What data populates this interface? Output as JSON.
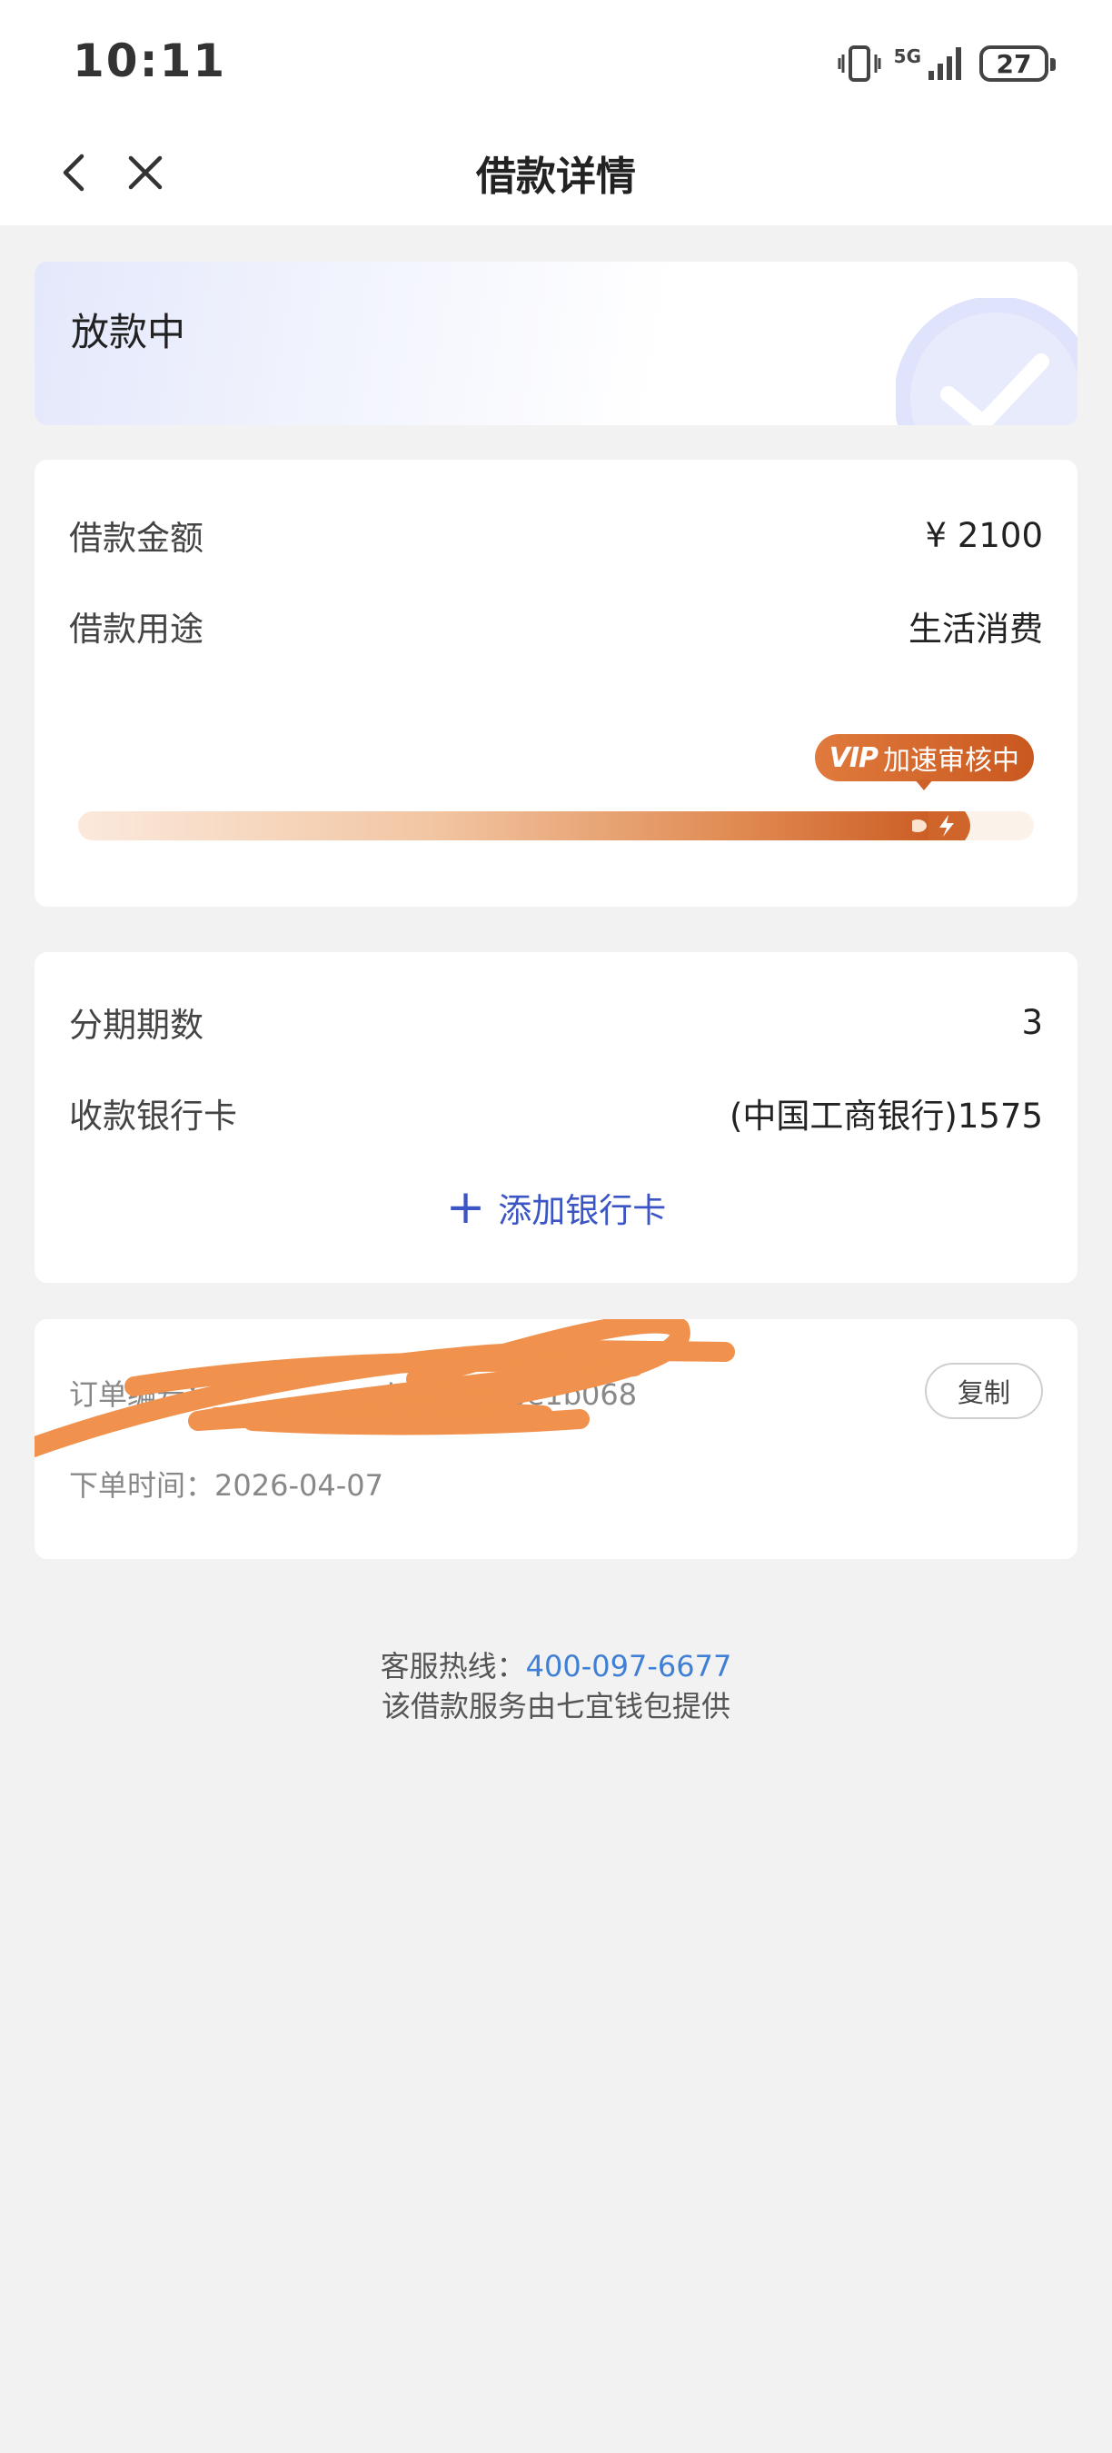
{
  "status_bar": {
    "time": "10:11",
    "network": "5G",
    "battery": "27",
    "icons": [
      "vibrate-icon",
      "signal-icon",
      "battery-icon"
    ]
  },
  "nav": {
    "title": "借款详情",
    "icons": [
      "back-icon",
      "close-icon"
    ]
  },
  "status_card": {
    "status": "放款中",
    "icon": "check-icon"
  },
  "loan_card": {
    "amount_label": "借款金额",
    "amount_value": "¥ 2100",
    "purpose_label": "借款用途",
    "purpose_value": "生活消费",
    "vip_mark": "VIP",
    "vip_text": "加速审核中",
    "progress_fraction": 0.92,
    "accent_color": "#c9581f"
  },
  "bank_card": {
    "installments_label": "分期期数",
    "installments_value": "3",
    "bank_label": "收款银行卡",
    "bank_value": "(中国工商银行)1575",
    "add_card_label": "添加银行卡",
    "link_color": "#3b55c4"
  },
  "order_card": {
    "order_no_label": "订单编号：",
    "order_no_visible": "b055fb0be1b068",
    "order_time_label": "下单时间：",
    "order_time_value": "2026-04-07",
    "copy_label": "复制",
    "redaction_color": "#f0914d"
  },
  "footer": {
    "hotline_label": "客服热线：",
    "hotline_number": "400-097-6677",
    "provider_text": "该借款服务由七宜钱包提供"
  }
}
